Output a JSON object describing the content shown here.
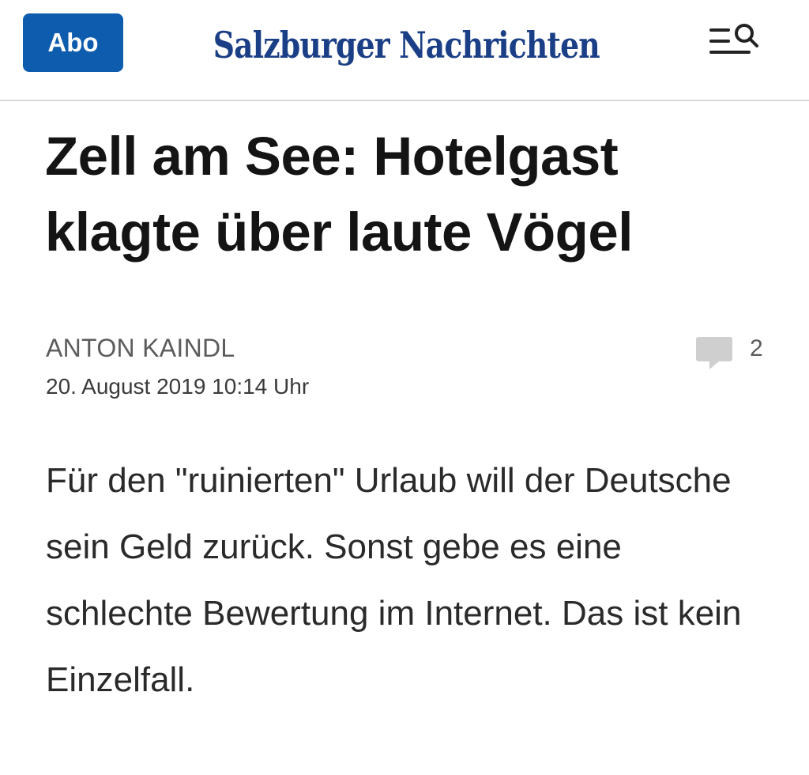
{
  "header": {
    "abo_label": "Abo",
    "logo_text": "Salzburger Nachrichten",
    "menu_search_icon": "menu-search-icon",
    "brand_color": "#1b3f86",
    "abo_color": "#0e5cad"
  },
  "article": {
    "headline": "Zell am See: Hotelgast klagte über laute Vögel",
    "author": "ANTON KAINDL",
    "date": "20. August 2019 10:14 Uhr",
    "comment_icon": "comment-icon",
    "comment_count": "2",
    "lead": "Für den \"ruinierten\" Urlaub will der Deutsche sein Geld zurück. Sonst gebe es eine schlechte Bewertung im Internet. Das ist kein Einzelfall."
  }
}
